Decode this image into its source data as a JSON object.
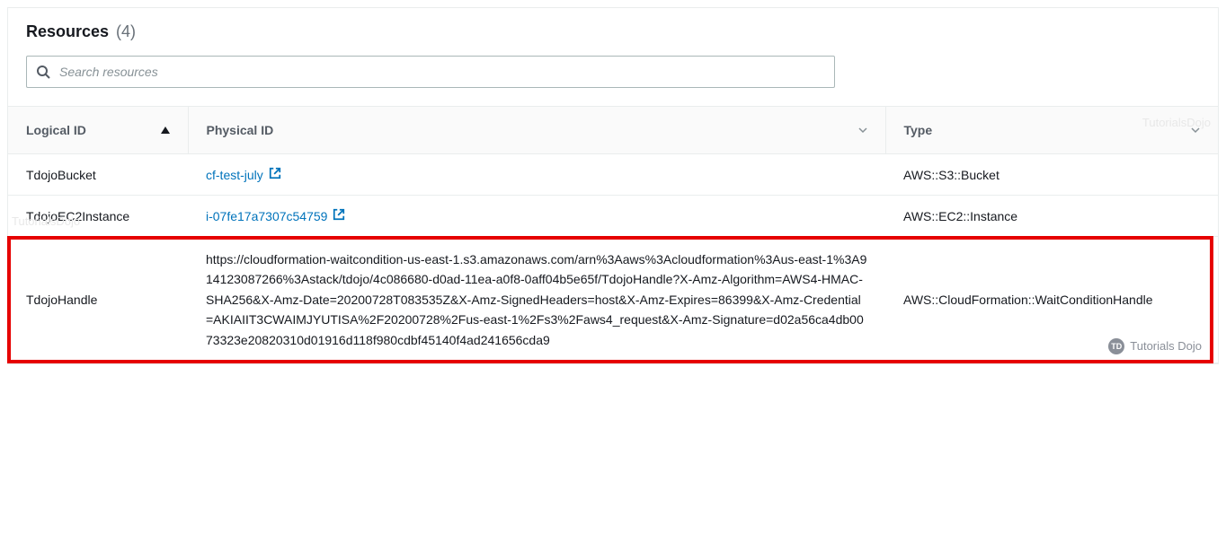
{
  "panel": {
    "title": "Resources",
    "count": "(4)"
  },
  "search": {
    "placeholder": "Search resources"
  },
  "columns": {
    "logical_id": "Logical ID",
    "physical_id": "Physical ID",
    "type": "Type"
  },
  "rows": [
    {
      "logical_id": "TdojoBucket",
      "physical_id": "cf-test-july",
      "is_link": true,
      "type": "AWS::S3::Bucket",
      "highlighted": false
    },
    {
      "logical_id": "TdojoEC2Instance",
      "physical_id": "i-07fe17a7307c54759",
      "is_link": true,
      "type": "AWS::EC2::Instance",
      "highlighted": false
    },
    {
      "logical_id": "TdojoHandle",
      "physical_id": "https://cloudformation-waitcondition-us-east-1.s3.amazonaws.com/arn%3Aaws%3Acloudformation%3Aus-east-1%3A914123087266%3Astack/tdojo/4c086680-d0ad-11ea-a0f8-0aff04b5e65f/TdojoHandle?X-Amz-Algorithm=AWS4-HMAC-SHA256&X-Amz-Date=20200728T083535Z&X-Amz-SignedHeaders=host&X-Amz-Expires=86399&X-Amz-Credential=AKIAIIT3CWAIMJYUTISA%2F20200728%2Fus-east-1%2Fs3%2Faws4_request&X-Amz-Signature=d02a56ca4db0073323e20820310d01916d118f980cdbf45140f4ad241656cda9",
      "is_link": false,
      "type": "AWS::CloudFormation::WaitConditionHandle",
      "highlighted": true
    }
  ],
  "watermark": {
    "small": "TutorialsDojo",
    "badge_short": "TD",
    "badge_label": "Tutorials Dojo"
  }
}
